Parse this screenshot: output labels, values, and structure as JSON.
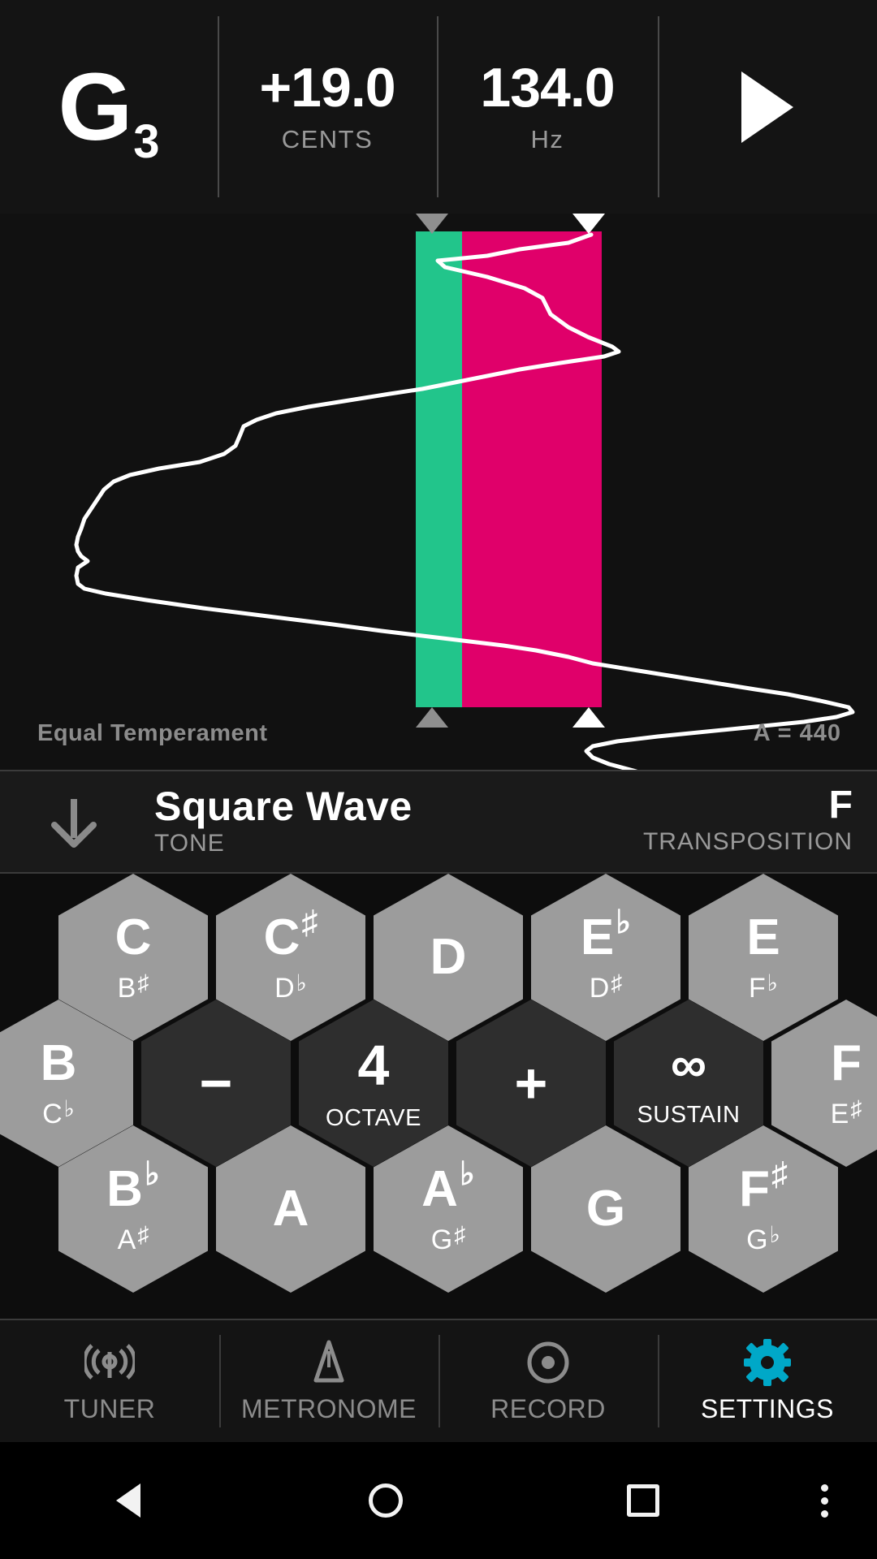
{
  "header": {
    "note_letter": "G",
    "note_octave": "3",
    "cents_value": "+19.0",
    "cents_label": "CENTS",
    "hz_value": "134.0",
    "hz_label": "Hz"
  },
  "tuner": {
    "temperament": "Equal  Temperament",
    "reference_pitch": "A  =  440",
    "in_tune_color": "#22c58b",
    "sharp_color": "#e0006a",
    "trace_color": "#ffffff",
    "background": "#111111"
  },
  "tone_bar": {
    "tone_value": "Square  Wave",
    "tone_label": "TONE",
    "transposition_value": "F",
    "transposition_label": "TRANSPOSITION"
  },
  "keyboard": {
    "rows": [
      [
        {
          "main": "C",
          "accidental": "",
          "sub": "B",
          "sub_accidental": "♯",
          "style": "light"
        },
        {
          "main": "C",
          "accidental": "♯",
          "sub": "D",
          "sub_accidental": "♭",
          "style": "light"
        },
        {
          "main": "D",
          "accidental": "",
          "sub": "",
          "sub_accidental": "",
          "style": "light"
        },
        {
          "main": "E",
          "accidental": "♭",
          "sub": "D",
          "sub_accidental": "♯",
          "style": "light"
        },
        {
          "main": "E",
          "accidental": "",
          "sub": "F",
          "sub_accidental": "♭",
          "style": "light"
        }
      ],
      [
        {
          "main": "B",
          "accidental": "",
          "sub": "C",
          "sub_accidental": "♭",
          "style": "light"
        },
        {
          "op": "−",
          "fn_label": "",
          "style": "dark",
          "name": "octave-down"
        },
        {
          "op": "4",
          "fn_label": "OCTAVE",
          "style": "dark",
          "name": "octave-value"
        },
        {
          "op": "+",
          "fn_label": "",
          "style": "dark",
          "name": "octave-up"
        },
        {
          "op": "∞",
          "fn_label": "SUSTAIN",
          "style": "dark",
          "name": "sustain"
        },
        {
          "main": "F",
          "accidental": "",
          "sub": "E",
          "sub_accidental": "♯",
          "style": "light"
        }
      ],
      [
        {
          "main": "B",
          "accidental": "♭",
          "sub": "A",
          "sub_accidental": "♯",
          "style": "light"
        },
        {
          "main": "A",
          "accidental": "",
          "sub": "",
          "sub_accidental": "",
          "style": "light"
        },
        {
          "main": "A",
          "accidental": "♭",
          "sub": "G",
          "sub_accidental": "♯",
          "style": "light"
        },
        {
          "main": "G",
          "accidental": "",
          "sub": "",
          "sub_accidental": "",
          "style": "light"
        },
        {
          "main": "F",
          "accidental": "♯",
          "sub": "G",
          "sub_accidental": "♭",
          "style": "light"
        }
      ]
    ]
  },
  "bottom_nav": {
    "items": [
      {
        "label": "TUNER",
        "icon": "tuner-signal-icon",
        "active": false
      },
      {
        "label": "METRONOME",
        "icon": "metronome-icon",
        "active": false
      },
      {
        "label": "RECORD",
        "icon": "record-dot-icon",
        "active": false
      },
      {
        "label": "SETTINGS",
        "icon": "gear-icon",
        "active": true
      }
    ],
    "active_color": "#00a8c8",
    "inactive_color": "#8c8c8c"
  },
  "system_nav": {
    "back": "back-triangle-icon",
    "home": "home-circle-icon",
    "recents": "recents-square-icon",
    "more": "overflow-dots-icon"
  },
  "chart_data": {
    "type": "line",
    "title": "",
    "xlabel": "",
    "ylabel": "",
    "orientation": "vertical-time",
    "description": "Pitch history trace scrolling downward; horizontal position = cents deviation, vertical = time.",
    "xlim": [
      0,
      1080
    ],
    "ylim": [
      0,
      685
    ],
    "grid": false,
    "legend": null,
    "bands": [
      {
        "name": "in-tune",
        "color": "#22c58b",
        "x_start": 512,
        "x_end": 569
      },
      {
        "name": "sharp",
        "color": "#e0006a",
        "x_start": 569,
        "x_end": 741
      }
    ],
    "markers": [
      {
        "name": "target-top",
        "x": 532,
        "y": 0,
        "color": "#8f8f8f"
      },
      {
        "name": "current-top",
        "x": 725,
        "y": 0,
        "color": "#ffffff"
      },
      {
        "name": "target-bottom",
        "x": 532,
        "y": 633,
        "color": "#8f8f8f"
      },
      {
        "name": "current-bottom",
        "x": 725,
        "y": 633,
        "color": "#ffffff"
      }
    ],
    "points": [
      [
        728,
        26
      ],
      [
        700,
        36
      ],
      [
        640,
        44
      ],
      [
        600,
        52
      ],
      [
        560,
        56
      ],
      [
        539,
        58
      ],
      [
        548,
        66
      ],
      [
        600,
        78
      ],
      [
        646,
        92
      ],
      [
        668,
        104
      ],
      [
        672,
        112
      ],
      [
        678,
        124
      ],
      [
        700,
        140
      ],
      [
        724,
        152
      ],
      [
        754,
        164
      ],
      [
        762,
        170
      ],
      [
        744,
        176
      ],
      [
        690,
        184
      ],
      [
        640,
        192
      ],
      [
        600,
        200
      ],
      [
        560,
        208
      ],
      [
        520,
        216
      ],
      [
        480,
        222
      ],
      [
        430,
        230
      ],
      [
        380,
        238
      ],
      [
        340,
        246
      ],
      [
        316,
        254
      ],
      [
        300,
        262
      ],
      [
        296,
        272
      ],
      [
        290,
        286
      ],
      [
        276,
        296
      ],
      [
        246,
        306
      ],
      [
        196,
        314
      ],
      [
        160,
        322
      ],
      [
        140,
        330
      ],
      [
        128,
        340
      ],
      [
        120,
        352
      ],
      [
        112,
        364
      ],
      [
        104,
        376
      ],
      [
        100,
        388
      ],
      [
        96,
        398
      ],
      [
        94,
        408
      ],
      [
        96,
        416
      ],
      [
        100,
        422
      ],
      [
        108,
        428
      ],
      [
        96,
        436
      ],
      [
        94,
        446
      ],
      [
        96,
        456
      ],
      [
        104,
        462
      ],
      [
        130,
        468
      ],
      [
        180,
        476
      ],
      [
        250,
        486
      ],
      [
        330,
        496
      ],
      [
        410,
        506
      ],
      [
        470,
        514
      ],
      [
        520,
        520
      ],
      [
        570,
        526
      ],
      [
        620,
        532
      ],
      [
        660,
        538
      ],
      [
        700,
        546
      ],
      [
        730,
        554
      ],
      [
        780,
        562
      ],
      [
        830,
        570
      ],
      [
        880,
        578
      ],
      [
        930,
        586
      ],
      [
        970,
        592
      ],
      [
        1010,
        600
      ],
      [
        1045,
        608
      ],
      [
        1050,
        614
      ],
      [
        1030,
        620
      ],
      [
        990,
        626
      ],
      [
        930,
        632
      ],
      [
        870,
        638
      ],
      [
        810,
        644
      ],
      [
        760,
        650
      ],
      [
        730,
        656
      ],
      [
        722,
        662
      ],
      [
        730,
        670
      ],
      [
        750,
        678
      ],
      [
        780,
        686
      ],
      [
        800,
        692
      ],
      [
        812,
        698
      ]
    ]
  }
}
